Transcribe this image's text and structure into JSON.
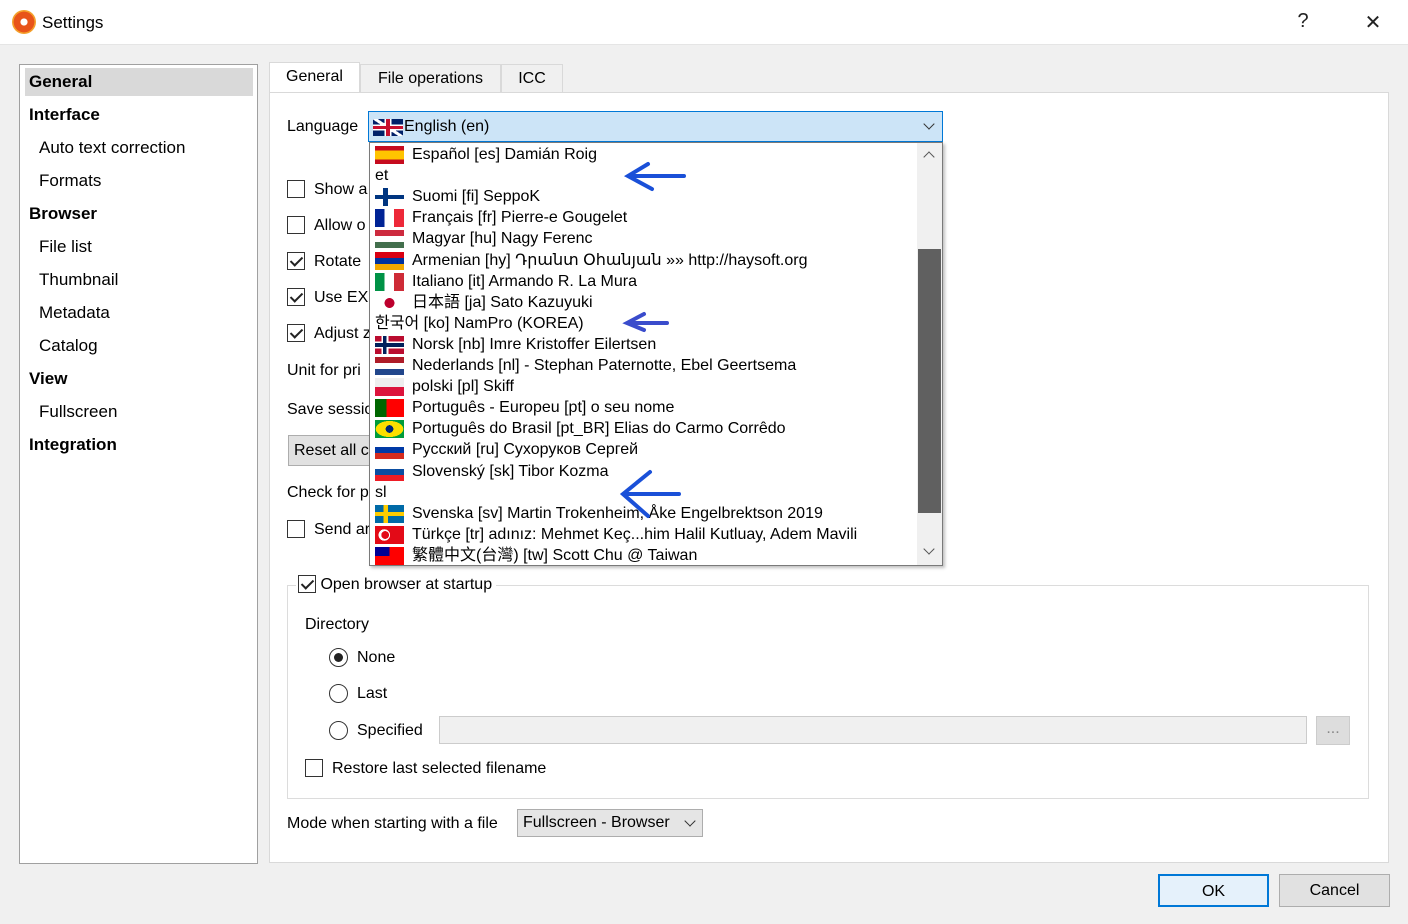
{
  "window": {
    "title": "Settings",
    "help": "?",
    "close": "✕"
  },
  "sidebar": {
    "items": [
      {
        "label": "General",
        "level": "header",
        "selected": true
      },
      {
        "label": "Interface",
        "level": "header"
      },
      {
        "label": "Auto text correction",
        "level": "sub"
      },
      {
        "label": "Formats",
        "level": "sub"
      },
      {
        "label": "Browser",
        "level": "header"
      },
      {
        "label": "File list",
        "level": "sub"
      },
      {
        "label": "Thumbnail",
        "level": "sub"
      },
      {
        "label": "Metadata",
        "level": "sub"
      },
      {
        "label": "Catalog",
        "level": "sub"
      },
      {
        "label": "View",
        "level": "header"
      },
      {
        "label": "Fullscreen",
        "level": "sub"
      },
      {
        "label": "Integration",
        "level": "header"
      }
    ]
  },
  "tabs": [
    {
      "label": "General",
      "active": true
    },
    {
      "label": "File operations"
    },
    {
      "label": "ICC"
    }
  ],
  "general": {
    "language_label": "Language",
    "language_value": "English (en)",
    "hidden_options": [
      "Show a",
      "Allow o",
      "Rotate",
      "Use EXI",
      "Adjust z"
    ],
    "hidden_checked": [
      false,
      false,
      true,
      true,
      true
    ],
    "unit_label": "Unit for pri",
    "save_session_label": "Save sessio",
    "reset_button": "Reset all c",
    "check_label": "Check for p",
    "send_label": "Send ar",
    "open_browser_label": "Open browser at startup",
    "directory_label": "Directory",
    "radio_none": "None",
    "radio_last": "Last",
    "radio_specified": "Specified",
    "specified_value": "",
    "browse_button": "...",
    "restore_label": "Restore last selected filename",
    "mode_label": "Mode when starting with a file",
    "mode_value": "Fullscreen - Browser"
  },
  "language_options": [
    {
      "flag": "es",
      "label": "Español [es] Damián Roig"
    },
    {
      "flag": "",
      "label": "et"
    },
    {
      "flag": "fi",
      "label": "Suomi [fi] SeppoK"
    },
    {
      "flag": "fr",
      "label": "Français [fr] Pierre-e Gougelet"
    },
    {
      "flag": "hu",
      "label": "Magyar [hu] Nagy Ferenc"
    },
    {
      "flag": "hy",
      "label": "Armenian [hy] Դրանտ Օհանյան »» http://haysoft.org"
    },
    {
      "flag": "it",
      "label": "Italiano [it] Armando R. La Mura"
    },
    {
      "flag": "ja",
      "label": "日本語 [ja] Sato Kazuyuki"
    },
    {
      "flag": "",
      "label": "한국어 [ko] NamPro (KOREA)"
    },
    {
      "flag": "nb",
      "label": "Norsk [nb] Imre Kristoffer Eilertsen"
    },
    {
      "flag": "nl",
      "label": "Nederlands [nl]  - Stephan Paternotte, Ebel Geertsema"
    },
    {
      "flag": "pl",
      "label": "polski [pl] Skiff"
    },
    {
      "flag": "pt",
      "label": "Português - Europeu [pt] o seu nome"
    },
    {
      "flag": "br",
      "label": "Português do Brasil [pt_BR] Elias do Carmo Corrêdo"
    },
    {
      "flag": "ru",
      "label": "Русский [ru] Сухоруков Сергей"
    },
    {
      "flag": "sk",
      "label": "Slovenský [sk] Tibor Kozma"
    },
    {
      "flag": "",
      "label": "sl"
    },
    {
      "flag": "sv",
      "label": "Svenska [sv] Martin Trokenheim, Åke Engelbrektson 2019"
    },
    {
      "flag": "tr",
      "label": "Türkçe [tr] adınız: Mehmet Keç...him Halil Kutluay, Adem Mavili"
    },
    {
      "flag": "tw",
      "label": "繁體中文(台灣) [tw] Scott Chu @ Taiwan"
    }
  ],
  "dialog": {
    "ok": "OK",
    "cancel": "Cancel"
  },
  "colors": {
    "accent": "#0078d7",
    "selection": "#cce4f7",
    "annotation_arrow": "#1a4fd6"
  }
}
